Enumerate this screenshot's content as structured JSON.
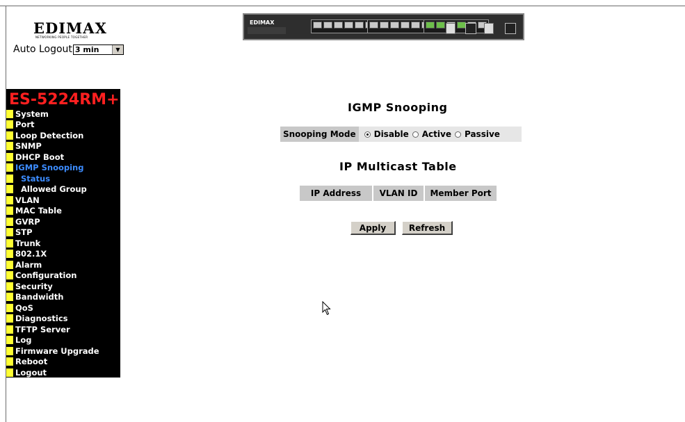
{
  "logo": {
    "brand": "EDIMAX",
    "tagline": "NETWORKING PEOPLE TOGETHER"
  },
  "auto_logout": {
    "label": "Auto Logout",
    "value": "3 min"
  },
  "switch_image": {
    "brand": "EDIMAX"
  },
  "sidebar": {
    "model": "ES-5224RM+",
    "items": [
      {
        "label": "System",
        "state": "normal"
      },
      {
        "label": "Port",
        "state": "normal"
      },
      {
        "label": "Loop Detection",
        "state": "normal"
      },
      {
        "label": "SNMP",
        "state": "normal"
      },
      {
        "label": "DHCP Boot",
        "state": "normal"
      },
      {
        "label": "IGMP Snooping",
        "state": "active"
      },
      {
        "label": "Status",
        "state": "sub-active"
      },
      {
        "label": "Allowed Group",
        "state": "sub"
      },
      {
        "label": "VLAN",
        "state": "normal"
      },
      {
        "label": "MAC Table",
        "state": "normal"
      },
      {
        "label": "GVRP",
        "state": "normal"
      },
      {
        "label": "STP",
        "state": "normal"
      },
      {
        "label": "Trunk",
        "state": "normal"
      },
      {
        "label": "802.1X",
        "state": "normal"
      },
      {
        "label": "Alarm",
        "state": "normal"
      },
      {
        "label": "Configuration",
        "state": "normal"
      },
      {
        "label": "Security",
        "state": "normal"
      },
      {
        "label": "Bandwidth",
        "state": "normal"
      },
      {
        "label": "QoS",
        "state": "normal"
      },
      {
        "label": "Diagnostics",
        "state": "normal"
      },
      {
        "label": "TFTP Server",
        "state": "normal"
      },
      {
        "label": "Log",
        "state": "normal"
      },
      {
        "label": "Firmware Upgrade",
        "state": "normal"
      },
      {
        "label": "Reboot",
        "state": "normal"
      },
      {
        "label": "Logout",
        "state": "normal"
      }
    ]
  },
  "main": {
    "title": "IGMP Snooping",
    "snooping_mode": {
      "label": "Snooping Mode",
      "options": [
        "Disable",
        "Active",
        "Passive"
      ],
      "selected": "Disable"
    },
    "table_title": "IP Multicast Table",
    "table_headers": [
      "IP Address",
      "VLAN ID",
      "Member Port"
    ],
    "buttons": {
      "apply": "Apply",
      "refresh": "Refresh"
    }
  },
  "colors": {
    "sidebar_bg": "#000000",
    "model_text": "#ff2020",
    "menu_marker": "#ffff33",
    "active_menu": "#3c8cff",
    "header_cell": "#c8c8c8"
  }
}
